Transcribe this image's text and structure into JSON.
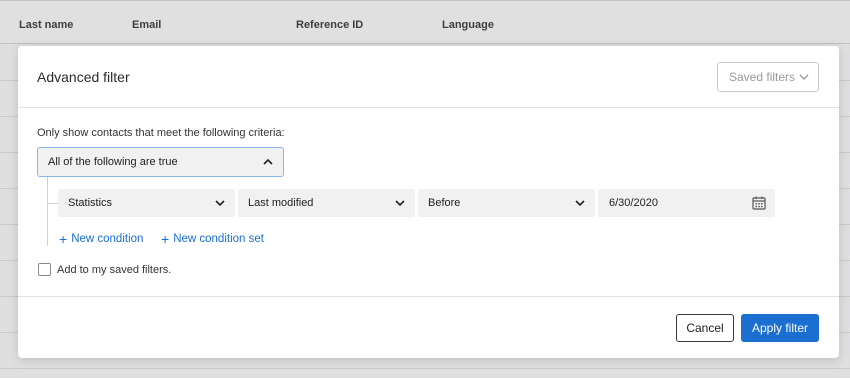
{
  "background_table": {
    "columns": [
      "Last name",
      "Email",
      "Reference ID",
      "Language"
    ]
  },
  "modal": {
    "title": "Advanced filter",
    "saved_filters_label": "Saved filters",
    "criteria_label": "Only show contacts that meet the following criteria:",
    "logic_selector": "All of the following are true",
    "condition": {
      "field": "Statistics",
      "attribute": "Last modified",
      "operator": "Before",
      "value": "6/30/2020"
    },
    "new_condition_label": "New condition",
    "new_condition_set_label": "New condition set",
    "save_checkbox_label": "Add to my saved filters.",
    "cancel_label": "Cancel",
    "apply_label": "Apply filter"
  },
  "colors": {
    "accent": "#1a6fd1",
    "focus_border": "#8ab6ec"
  },
  "icons": [
    "chevron-down-icon",
    "chevron-up-icon",
    "calendar-icon",
    "plus-icon"
  ]
}
